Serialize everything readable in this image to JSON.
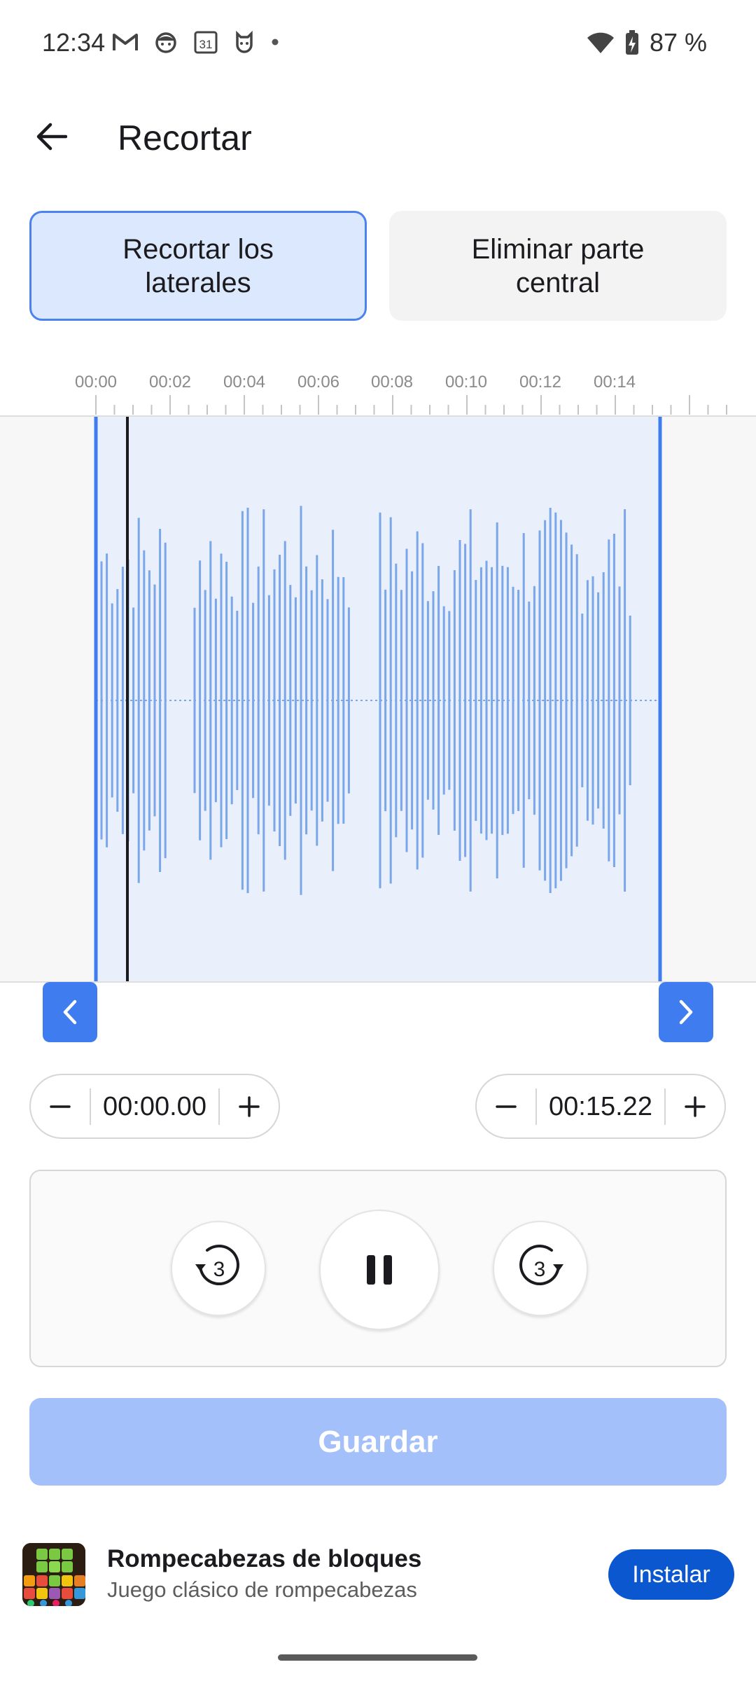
{
  "status_bar": {
    "time": "12:34",
    "battery_text": "87 %",
    "left_icons": [
      "gmail-icon",
      "face-icon",
      "calendar-icon",
      "mi-icon",
      "dot-icon"
    ],
    "calendar_day": "31",
    "right_icons": [
      "wifi-icon",
      "battery-charging-icon"
    ]
  },
  "app_bar": {
    "title": "Recortar"
  },
  "modes": {
    "trim_sides": "Recortar los laterales",
    "remove_middle": "Eliminar parte central",
    "selected": "trim_sides"
  },
  "timeline": {
    "tick_labels": [
      "00:00",
      "00:02",
      "00:04",
      "00:06",
      "00:08",
      "00:10",
      "00:12",
      "00:14"
    ],
    "accent_color": "#3f7cef",
    "selection_color": "#e9effb",
    "waveform_color": "#7aa6ea"
  },
  "trim": {
    "start": "00:00.00",
    "end": "00:15.22"
  },
  "player": {
    "rewind_seconds": "3",
    "forward_seconds": "3",
    "state": "playing"
  },
  "save_label": "Guardar",
  "ad": {
    "title": "Rompecabezas de bloques",
    "subtitle": "Juego clásico de rompecabezas",
    "install_label": "Instalar"
  }
}
